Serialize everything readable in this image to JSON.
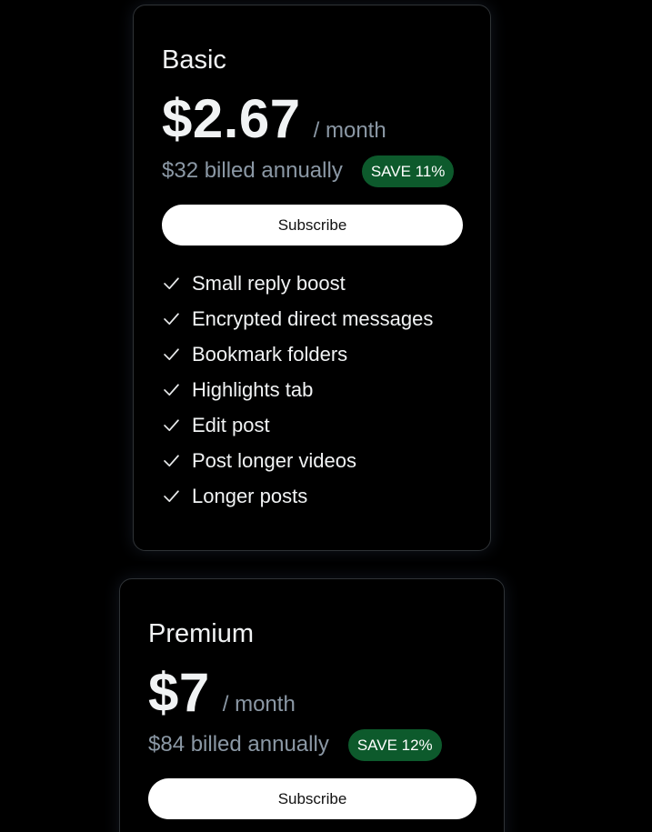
{
  "plans": [
    {
      "name": "Basic",
      "price": "$2.67",
      "period": "/ month",
      "billing": "$32 billed annually",
      "save": "SAVE 11%",
      "subscribe_label": "Subscribe",
      "features": [
        "Small reply boost",
        "Encrypted direct messages",
        "Bookmark folders",
        "Highlights tab",
        "Edit post",
        "Post longer videos",
        "Longer posts"
      ]
    },
    {
      "name": "Premium",
      "price": "$7",
      "period": "/ month",
      "billing": "$84 billed annually",
      "save": "SAVE 12%",
      "subscribe_label": "Subscribe"
    }
  ],
  "icons": {
    "feature_bullet": "check-icon"
  },
  "colors": {
    "background": "#000000",
    "save_badge": "#0d5a2c",
    "subscribe_button": "#ffffff",
    "muted_text": "#8b98a5"
  }
}
